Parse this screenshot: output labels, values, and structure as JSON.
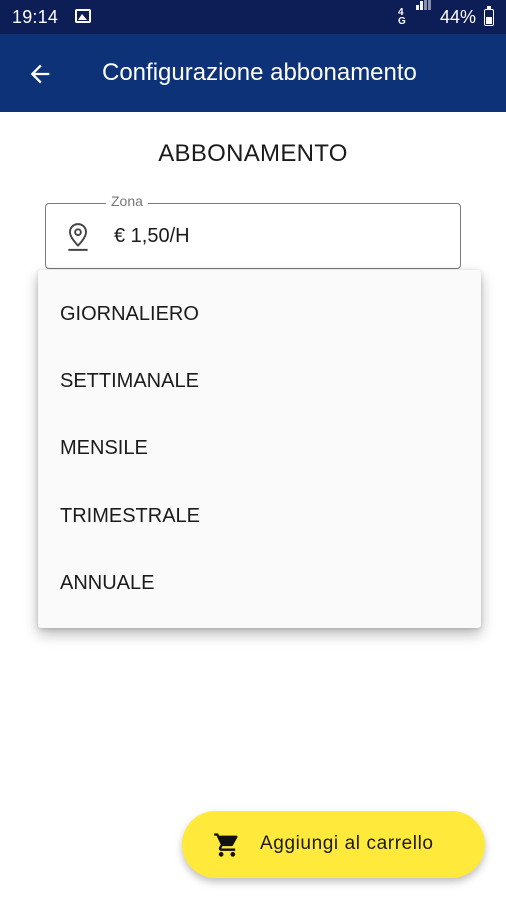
{
  "status_bar": {
    "time": "19:14",
    "network": "4G",
    "battery": "44%",
    "icons": [
      "image-icon",
      "network-icon",
      "signal-icon",
      "battery-icon"
    ]
  },
  "app_bar": {
    "title": "Configurazione abbonamento",
    "back_icon": "arrow-left-icon",
    "background": "#0d3277"
  },
  "main": {
    "section_title": "ABBONAMENTO",
    "zona_field": {
      "label": "Zona",
      "value": "€ 1,50/H",
      "icon": "location-pin-icon"
    },
    "dropdown_options": [
      {
        "label": "GIORNALIERO"
      },
      {
        "label": "SETTIMANALE"
      },
      {
        "label": "MENSILE"
      },
      {
        "label": "TRIMESTRALE"
      },
      {
        "label": "ANNUALE"
      }
    ]
  },
  "cart_button": {
    "label": "Aggiungi al carrello",
    "icon": "cart-icon",
    "color": "#ffe93a"
  }
}
